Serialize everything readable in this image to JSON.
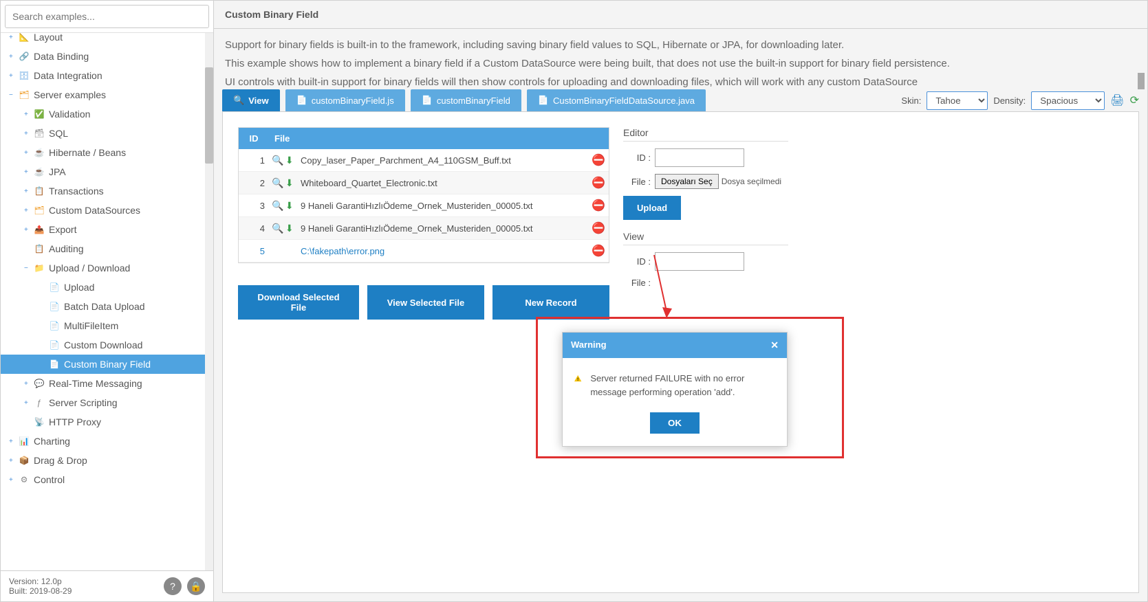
{
  "search": {
    "placeholder": "Search examples..."
  },
  "tree": {
    "items": [
      {
        "level": 0,
        "toggle": "+",
        "icon": "📐",
        "label": "Layout",
        "color": "#6aa8e0",
        "cut": true
      },
      {
        "level": 0,
        "toggle": "+",
        "icon": "🔗",
        "label": "Data Binding",
        "color": "#6aa8e0"
      },
      {
        "level": 0,
        "toggle": "+",
        "icon": "🗄",
        "label": "Data Integration",
        "color": "#6aa8e0"
      },
      {
        "level": 0,
        "toggle": "−",
        "icon": "🗂",
        "label": "Server examples",
        "color": "#f0a030"
      },
      {
        "level": 1,
        "toggle": "+",
        "icon": "✅",
        "label": "Validation",
        "color": "#4aa050"
      },
      {
        "level": 1,
        "toggle": "+",
        "icon": "🗃",
        "label": "SQL",
        "color": "#888"
      },
      {
        "level": 1,
        "toggle": "+",
        "icon": "☕",
        "label": "Hibernate / Beans",
        "color": "#7a4a2a"
      },
      {
        "level": 1,
        "toggle": "+",
        "icon": "☕",
        "label": "JPA",
        "color": "#7a4a2a"
      },
      {
        "level": 1,
        "toggle": "+",
        "icon": "📋",
        "label": "Transactions",
        "color": "#4a90d9"
      },
      {
        "level": 1,
        "toggle": "+",
        "icon": "🗂",
        "label": "Custom DataSources",
        "color": "#f0a030"
      },
      {
        "level": 1,
        "toggle": "+",
        "icon": "📤",
        "label": "Export",
        "color": "#4aa050"
      },
      {
        "level": 1,
        "toggle": "",
        "icon": "📋",
        "label": "Auditing",
        "color": "#4a90d9"
      },
      {
        "level": 1,
        "toggle": "−",
        "icon": "📁",
        "label": "Upload / Download",
        "color": "#f0a030"
      },
      {
        "level": 2,
        "toggle": "",
        "icon": "📄",
        "label": "Upload",
        "color": "#4a90d9"
      },
      {
        "level": 2,
        "toggle": "",
        "icon": "📄",
        "label": "Batch Data Upload",
        "color": "#f0a030"
      },
      {
        "level": 2,
        "toggle": "",
        "icon": "📄",
        "label": "MultiFileItem",
        "color": "#4a90d9"
      },
      {
        "level": 2,
        "toggle": "",
        "icon": "📄",
        "label": "Custom Download",
        "color": "#4a90d9"
      },
      {
        "level": 2,
        "toggle": "",
        "icon": "📄",
        "label": "Custom Binary Field",
        "color": "#4a90d9",
        "selected": true
      },
      {
        "level": 1,
        "toggle": "+",
        "icon": "💬",
        "label": "Real-Time Messaging",
        "color": "#f0a030"
      },
      {
        "level": 1,
        "toggle": "+",
        "icon": "ƒ",
        "label": "Server Scripting",
        "color": "#888"
      },
      {
        "level": 1,
        "toggle": "",
        "icon": "📡",
        "label": "HTTP Proxy",
        "color": "#f08030"
      },
      {
        "level": 0,
        "toggle": "+",
        "icon": "📊",
        "label": "Charting",
        "color": "#f0a030"
      },
      {
        "level": 0,
        "toggle": "+",
        "icon": "📦",
        "label": "Drag & Drop",
        "color": "#7a9e4a"
      },
      {
        "level": 0,
        "toggle": "+",
        "icon": "⚙",
        "label": "Control",
        "color": "#888"
      }
    ]
  },
  "footer": {
    "version": "Version: 12.0p",
    "built": "Built: 2019-08-29"
  },
  "header": {
    "title": "Custom Binary Field"
  },
  "description": {
    "p1": "Support for binary fields is built-in to the framework, including saving binary field values to SQL, Hibernate or JPA, for downloading later.",
    "p2": "This example shows how to implement a binary field if a Custom DataSource were being built, that does not use the built-in support for binary field persistence.",
    "p3": "UI controls with built-in support for binary fields will then show controls for uploading and downloading files, which will work with any custom DataSource"
  },
  "tabs": [
    {
      "icon": "🔍",
      "label": "View",
      "active": true
    },
    {
      "icon": "📄",
      "label": "customBinaryField.js"
    },
    {
      "icon": "📄",
      "label": "customBinaryField"
    },
    {
      "icon": "📄",
      "label": "CustomBinaryFieldDataSource.java"
    }
  ],
  "skin": {
    "label": "Skin:",
    "value": "Tahoe"
  },
  "density": {
    "label": "Density:",
    "value": "Spacious"
  },
  "grid": {
    "headers": {
      "id": "ID",
      "file": "File"
    },
    "rows": [
      {
        "id": "1",
        "file": "Copy_laser_Paper_Parchment_A4_110GSM_Buff.txt",
        "icons": true
      },
      {
        "id": "2",
        "file": "Whiteboard_Quartet_Electronic.txt",
        "icons": true
      },
      {
        "id": "3",
        "file": "9 Haneli GarantiHızlıÖdeme_Ornek_Musteriden_00005.txt",
        "icons": true
      },
      {
        "id": "4",
        "file": "9 Haneli GarantiHızlıÖdeme_Ornek_Musteriden_00005.txt",
        "icons": true
      },
      {
        "id": "5",
        "file": "C:\\fakepath\\error.png",
        "icons": false,
        "selected": true
      }
    ]
  },
  "buttons": {
    "download": "Download Selected File",
    "view": "View Selected File",
    "new": "New Record"
  },
  "editor": {
    "title": "Editor",
    "id_label": "ID :",
    "file_label": "File :",
    "choose": "Dosyaları Seç",
    "nofile": "Dosya seçilmedi",
    "upload": "Upload"
  },
  "view": {
    "title": "View",
    "id_label": "ID :",
    "file_label": "File :"
  },
  "dialog": {
    "title": "Warning",
    "message": "Server returned FAILURE with no error message performing operation 'add'.",
    "ok": "OK"
  }
}
